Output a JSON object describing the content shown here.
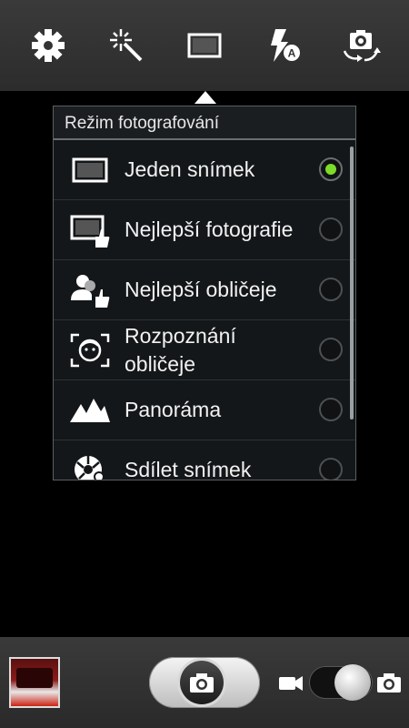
{
  "toolbar": {
    "buttons": [
      {
        "icon": "gear-icon"
      },
      {
        "icon": "magic-wand-icon"
      },
      {
        "icon": "shooting-mode-icon"
      },
      {
        "icon": "flash-auto-icon"
      },
      {
        "icon": "switch-camera-icon"
      }
    ]
  },
  "popup": {
    "title": "Režim fotografování",
    "items": [
      {
        "label": "Jeden snímek",
        "icon": "single-shot-icon",
        "selected": true
      },
      {
        "label": "Nejlepší fotografie",
        "icon": "best-photo-icon",
        "selected": false
      },
      {
        "label": "Nejlepší obličeje",
        "icon": "best-faces-icon",
        "selected": false
      },
      {
        "label": "Rozpoznání obličeje",
        "icon": "face-detection-icon",
        "selected": false
      },
      {
        "label": "Panoráma",
        "icon": "panorama-icon",
        "selected": false
      },
      {
        "label": "Sdílet snímek",
        "icon": "share-shot-icon",
        "selected": false
      }
    ]
  },
  "colors": {
    "accent": "#7ddc2a",
    "popup_bg": "#141719",
    "bar_bg": "#333333"
  },
  "bottom": {
    "mode": "photo"
  }
}
